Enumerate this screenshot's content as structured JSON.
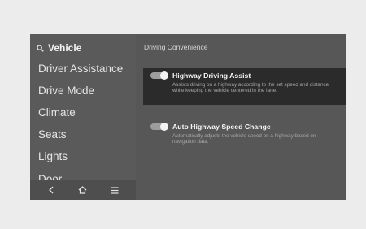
{
  "sidebar": {
    "header_label": "Vehicle",
    "items": [
      {
        "label": "Driver Assistance"
      },
      {
        "label": "Drive Mode"
      },
      {
        "label": "Climate"
      },
      {
        "label": "Seats"
      },
      {
        "label": "Lights"
      },
      {
        "label": "Door"
      }
    ],
    "nav_icons": [
      "back-icon",
      "home-icon",
      "menu-icon"
    ]
  },
  "content": {
    "section_title": "Driving Convenience",
    "options": [
      {
        "title": "Highway Driving Assist",
        "enabled": true,
        "description": "Assists driving on a highway according to the set speed and distance while keeping the vehicle centered in the lane."
      },
      {
        "title": "Auto Highway Speed Change",
        "enabled": true,
        "description": "Automatically adjusts the vehicle speed on a highway based on navigation data."
      }
    ]
  },
  "colors": {
    "screen_bg": "#575757",
    "highlight_bg": "#2b2b2b",
    "frame_bg": "#ececec"
  }
}
